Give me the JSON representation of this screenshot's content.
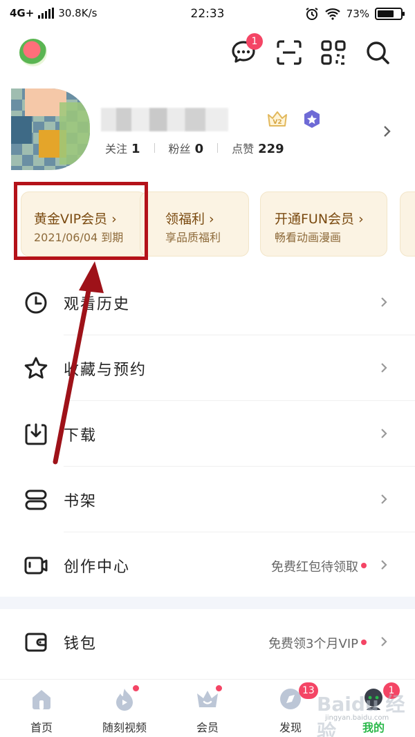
{
  "status_bar": {
    "network": "4G+",
    "speed": "30.8K/s",
    "time": "22:33",
    "battery": "73%",
    "battery_level": 0.73
  },
  "top_bar": {
    "message_badge": "1",
    "icons": [
      "app-logo-icon",
      "message-icon",
      "scan-icon",
      "qr-code-icon",
      "search-icon"
    ]
  },
  "profile": {
    "stats": [
      {
        "label": "关注",
        "value": "1"
      },
      {
        "label": "粉丝",
        "value": "0"
      },
      {
        "label": "点赞",
        "value": "229"
      }
    ]
  },
  "cards": [
    {
      "title": "黄金VIP会员 ›",
      "subtitle": "2021/06/04 到期"
    },
    {
      "title": "领福利 ›",
      "subtitle": "享品质福利"
    },
    {
      "title": "开通FUN会员 ›",
      "subtitle": "畅看动画漫画"
    }
  ],
  "menu": [
    {
      "label": "观看历史",
      "icon": "clock-icon"
    },
    {
      "label": "收藏与预约",
      "icon": "star-icon"
    },
    {
      "label": "下载",
      "icon": "download-icon"
    },
    {
      "label": "书架",
      "icon": "bookshelf-icon"
    },
    {
      "label": "创作中心",
      "icon": "video-camera-icon",
      "hint": "免费红包待领取"
    },
    {
      "label": "钱包",
      "icon": "wallet-icon",
      "hint": "免费领3个月VIP"
    }
  ],
  "bottom_nav": [
    {
      "label": "首页",
      "icon": "home-icon"
    },
    {
      "label": "随刻视频",
      "icon": "video-flame-icon"
    },
    {
      "label": "会员",
      "icon": "crown-icon"
    },
    {
      "label": "发现",
      "icon": "compass-icon",
      "badge": "13"
    },
    {
      "label": "我的",
      "icon": "user-avatar-icon",
      "badge": "1"
    }
  ],
  "watermark": {
    "text": "Baidu 经验",
    "sub": "jingyan.baidu.com"
  },
  "colors": {
    "accent": "#f44565",
    "active_tab": "#2ab84a",
    "card_bg": "#fbf3e3",
    "card_title": "#7a4a10",
    "highlight_box": "#b4121a"
  }
}
